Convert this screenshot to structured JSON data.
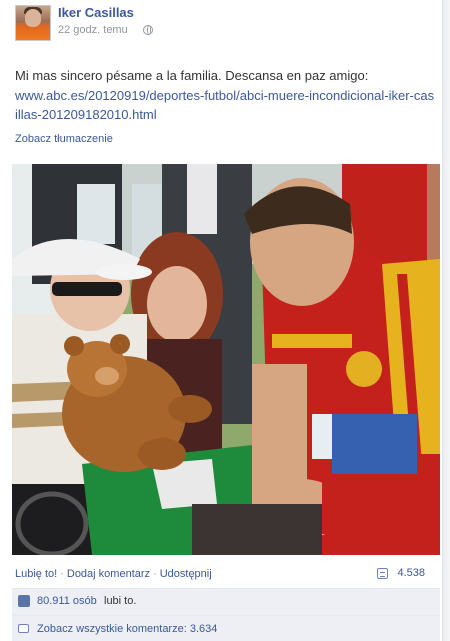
{
  "post": {
    "author": "Iker Casillas",
    "time": "22 godz. temu",
    "message": "Mi mas sincero pésame a la familia. Descansa en paz amigo:",
    "link": "www.abc.es/20120919/deportes-futbol/abci-muere-incondicional-iker-casillas-201209182010.html",
    "translate": "Zobacz tłumaczenie",
    "photo_icon": "photo-of-goalkeeper-with-boy"
  },
  "actions": {
    "like": "Lubię to!",
    "comment": "Dodaj komentarz",
    "share": "Udostępnij",
    "separator": "·",
    "share_count": "4.538"
  },
  "likes": {
    "count": "80.911 osób",
    "suffix": "lubi to."
  },
  "comments": {
    "view_all": "Zobacz wszystkie komentarze: 3.634"
  },
  "colors": {
    "link": "#3b5998",
    "bar_background": "#edeff4"
  }
}
